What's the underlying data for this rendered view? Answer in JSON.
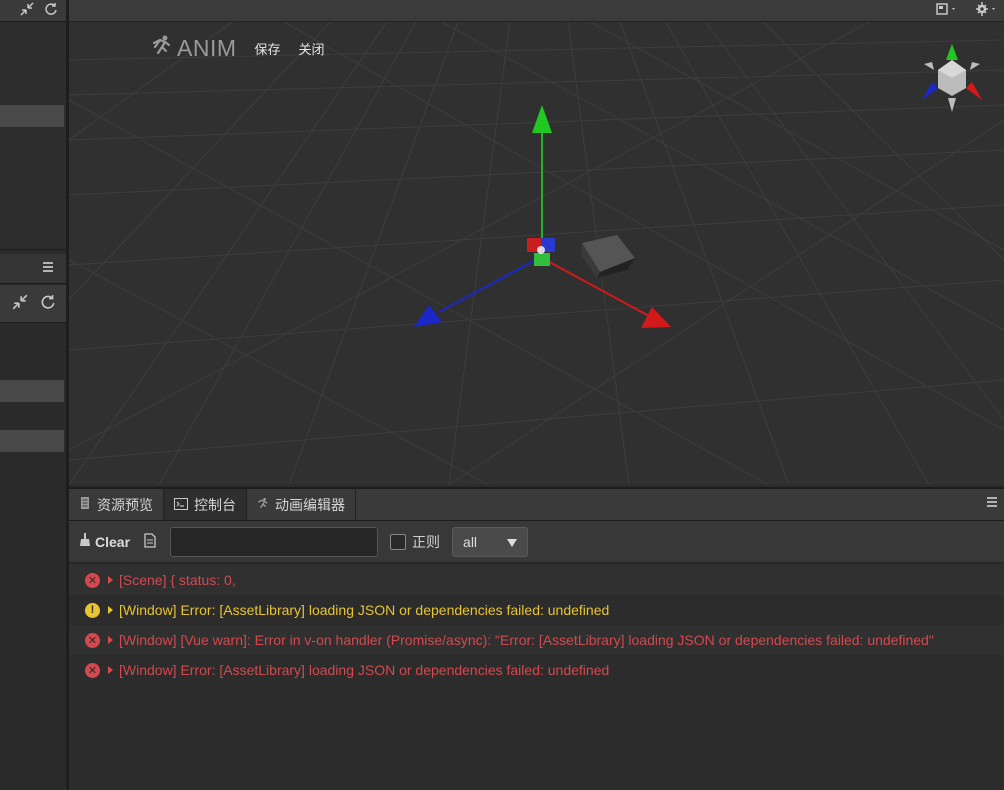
{
  "scene": {
    "anim_label": "ANIM",
    "save_label": "保存",
    "close_label": "关闭"
  },
  "tabs": [
    {
      "label": "资源预览",
      "icon": "file-icon"
    },
    {
      "label": "控制台",
      "icon": "console-icon"
    },
    {
      "label": "动画编辑器",
      "icon": "anim-icon"
    }
  ],
  "toolbar": {
    "clear_label": "Clear",
    "filter_value": "",
    "regex_label": "正则",
    "level_value": "all"
  },
  "logs": [
    {
      "level": "error",
      "text": "[Scene] { status: 0,"
    },
    {
      "level": "warn",
      "text": "[Window] Error: [AssetLibrary] loading JSON or dependencies failed: undefined"
    },
    {
      "level": "error",
      "text": "[Window] [Vue warn]: Error in v-on handler (Promise/async): \"Error: [AssetLibrary] loading JSON or dependencies failed: undefined\""
    },
    {
      "level": "error",
      "text": "[Window] Error: [AssetLibrary] loading JSON or dependencies failed: undefined"
    }
  ],
  "colors": {
    "error": "#d4494f",
    "warning": "#e8c431",
    "axis_x": "#d21a1a",
    "axis_y": "#22b322",
    "axis_z": "#1a28c8"
  }
}
